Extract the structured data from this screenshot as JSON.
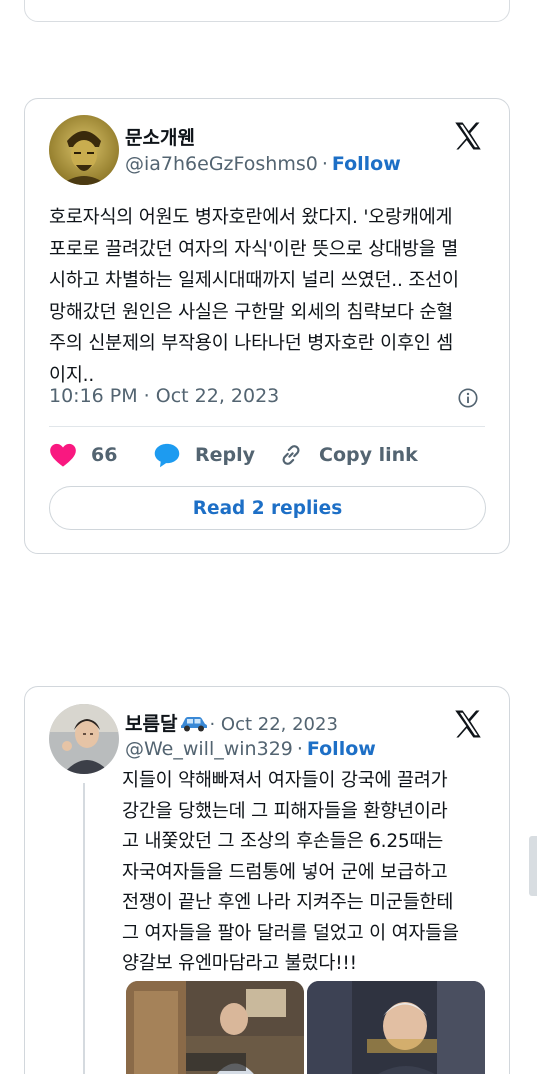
{
  "tweet1": {
    "display_name": "문소개웬",
    "handle": "@ia7h6eGzFoshms0",
    "separator": "·",
    "follow_label": "Follow",
    "text": "호로자식의 어원도 병자호란에서 왔다지. '오랑캐에게\n포로로 끌려갔던 여자의 자식'이란 뜻으로 상대방을 멸\n시하고 차별하는 일제시대때까지 널리 쓰였던.. 조선이\n망해갔던 원인은 사실은 구한말 외세의 침략보다 순혈\n주의 신분제의 부작용이 나타나던 병자호란 이후인 셈\n이지..",
    "timestamp": "10:16 PM · Oct 22, 2023",
    "likes": "66",
    "reply_label": "Reply",
    "copy_label": "Copy link",
    "read_replies_label": "Read 2 replies"
  },
  "tweet2": {
    "display_name": "보름달",
    "date": "· Oct 22, 2023",
    "handle": "@We_will_win329",
    "separator": "·",
    "follow_label": "Follow",
    "text": "지들이 약해빠져서 여자들이 강국에 끌려가\n강간을 당했는데 그 피해자들을 환향년이라\n고 내쫓았던 그 조상의 후손들은 6.25때는\n자국여자들을 드럼통에 넣어 군에 보급하고\n전쟁이 끝난 후엔 나라 지켜주는 미군들한테\n그 여자들을 팔아 달러를 덜었고 이 여자들을\n양갈보 유엔마담라고 불렀다!!!"
  },
  "colors": {
    "accent_blue": "#1d6fc6",
    "like_pink": "#f91880",
    "muted_gray": "#536471",
    "border": "#d2d7dc"
  },
  "icons": {
    "x_logo": "x-logo-icon",
    "heart": "heart-icon",
    "reply": "speech-bubble-icon",
    "copy": "link-icon",
    "info": "info-icon",
    "car": "car-emoji-icon"
  }
}
